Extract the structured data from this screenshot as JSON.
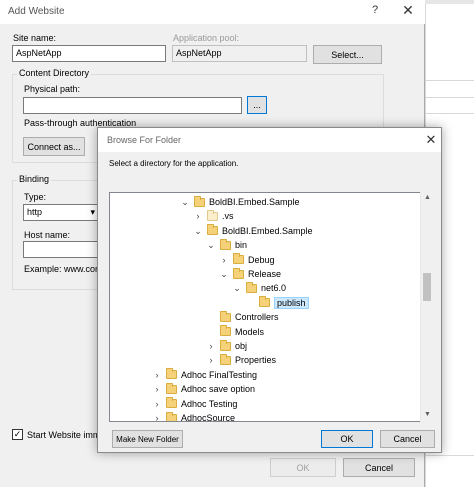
{
  "add_website": {
    "title": "Add Website",
    "help_glyph": "?",
    "close_glyph": "✕",
    "site_name_label": "Site name:",
    "site_name_value": "AspNetApp",
    "app_pool_label": "Application pool:",
    "app_pool_value": "AspNetApp",
    "select_button": "Select...",
    "content_directory_label": "Content Directory",
    "physical_path_label": "Physical path:",
    "physical_path_value": "",
    "browse_button": "...",
    "pass_through_label": "Pass-through authentication",
    "connect_as_button": "Connect as...",
    "binding_label": "Binding",
    "type_label": "Type:",
    "type_value": "http",
    "host_name_label": "Host name:",
    "host_name_value": "",
    "example_label": "Example: www.con",
    "start_website_label": "Start Website imme",
    "start_website_checked": true,
    "ok_button": "OK",
    "cancel_button": "Cancel"
  },
  "browse_folder": {
    "title": "Browse For Folder",
    "close_glyph": "✕",
    "prompt": "Select a directory for the application.",
    "tree": [
      {
        "label": "BoldBI.Embed.Sample",
        "depth": 0,
        "chevron": "expanded",
        "pale": false,
        "selected": false
      },
      {
        "label": ".vs",
        "depth": 1,
        "chevron": "collapsed",
        "pale": true,
        "selected": false
      },
      {
        "label": "BoldBI.Embed.Sample",
        "depth": 1,
        "chevron": "expanded",
        "pale": false,
        "selected": false
      },
      {
        "label": "bin",
        "depth": 2,
        "chevron": "expanded",
        "pale": false,
        "selected": false
      },
      {
        "label": "Debug",
        "depth": 3,
        "chevron": "collapsed",
        "pale": false,
        "selected": false
      },
      {
        "label": "Release",
        "depth": 3,
        "chevron": "expanded",
        "pale": false,
        "selected": false
      },
      {
        "label": "net6.0",
        "depth": 4,
        "chevron": "expanded",
        "pale": false,
        "selected": false
      },
      {
        "label": "publish",
        "depth": 5,
        "chevron": "none",
        "pale": false,
        "selected": true
      },
      {
        "label": "Controllers",
        "depth": 2,
        "chevron": "none",
        "pale": false,
        "selected": false
      },
      {
        "label": "Models",
        "depth": 2,
        "chevron": "none",
        "pale": false,
        "selected": false
      },
      {
        "label": "obj",
        "depth": 2,
        "chevron": "collapsed",
        "pale": false,
        "selected": false
      },
      {
        "label": "Properties",
        "depth": 2,
        "chevron": "collapsed",
        "pale": false,
        "selected": false
      },
      {
        "label": "Adhoc FinalTesting",
        "depth": -1,
        "chevron": "collapsed",
        "pale": false,
        "selected": false
      },
      {
        "label": "Adhoc save option",
        "depth": -1,
        "chevron": "collapsed",
        "pale": false,
        "selected": false
      },
      {
        "label": "Adhoc Testing",
        "depth": -1,
        "chevron": "collapsed",
        "pale": false,
        "selected": false
      },
      {
        "label": "AdhocSource",
        "depth": -1,
        "chevron": "collapsed",
        "pale": false,
        "selected": false
      }
    ],
    "make_new_folder_button": "Make New Folder",
    "ok_button": "OK",
    "cancel_button": "Cancel"
  },
  "glyphs": {
    "chevron_expanded": "⌄",
    "chevron_collapsed": "›",
    "scroll_up": "▲",
    "scroll_down": "▼",
    "checkmark": "✓",
    "dropdown": "▾"
  },
  "colors": {
    "accent": "#0078d7",
    "selection_bg": "#cce8ff",
    "folder": "#f5d27a"
  }
}
